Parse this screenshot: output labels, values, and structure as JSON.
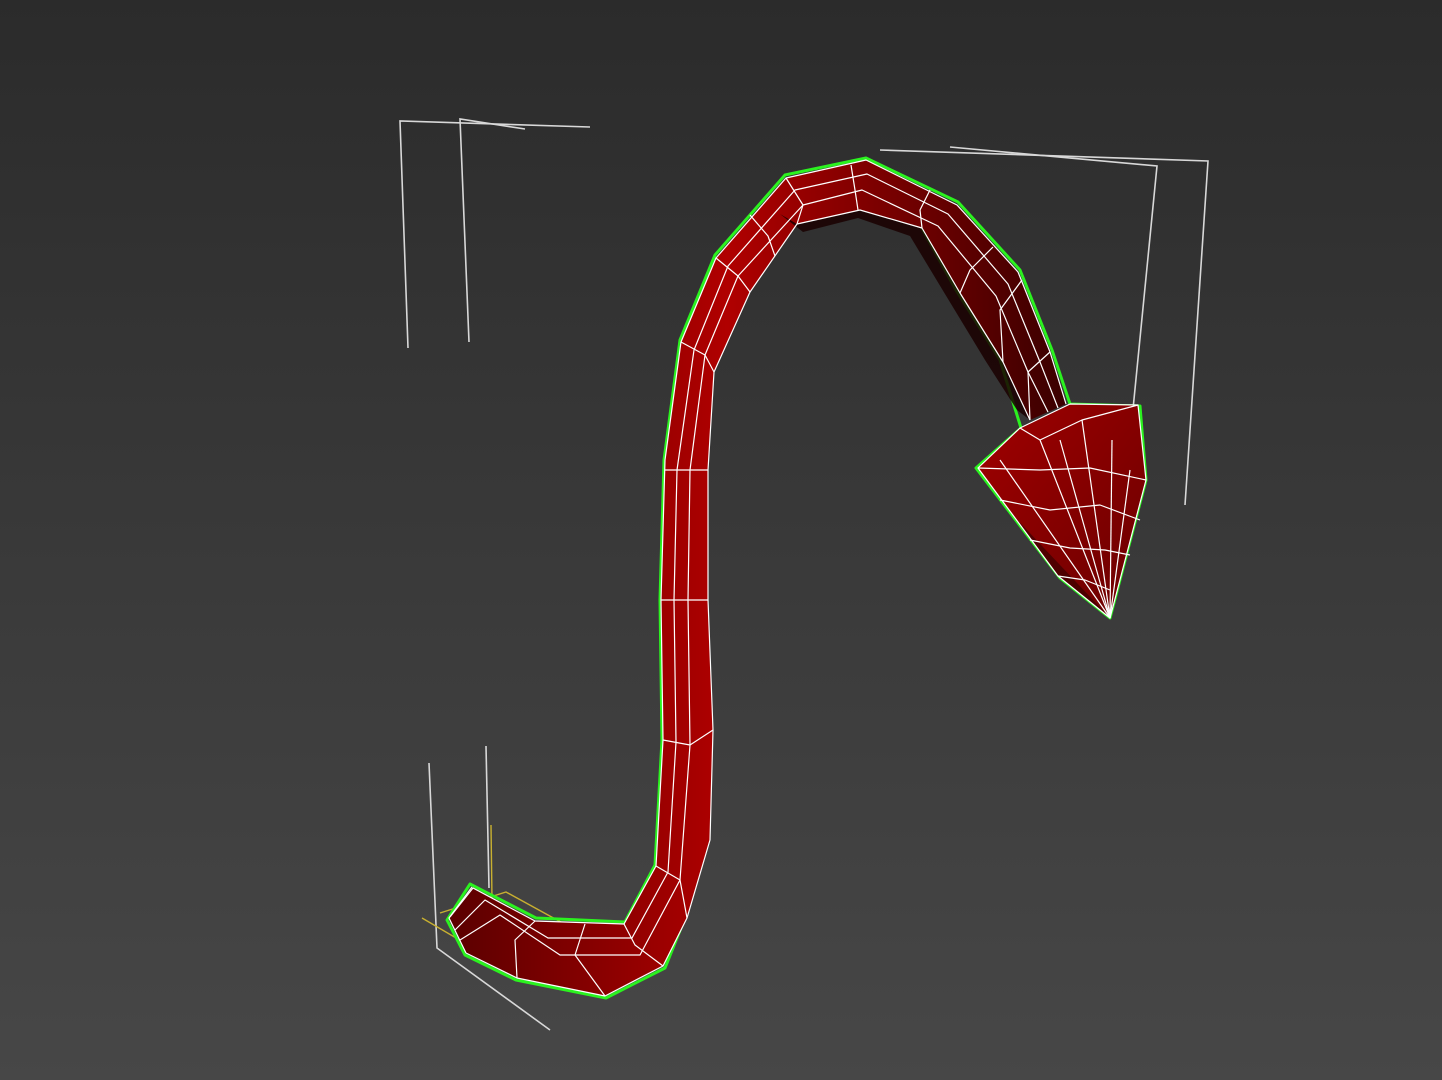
{
  "viewport": {
    "background_top": "#2b2b2b",
    "background_bottom": "#474747"
  },
  "object": {
    "name": "devil-tail",
    "fill_color": "#8e0000",
    "fill_dark": "#3d0000",
    "wire_color": "#ffffff",
    "selection_outline_color": "#2bf21f",
    "bracket_color": "#d8d8d8",
    "gizmo_color": "#c8b030",
    "shading": "wireframe-on-shaded",
    "selected": true
  }
}
